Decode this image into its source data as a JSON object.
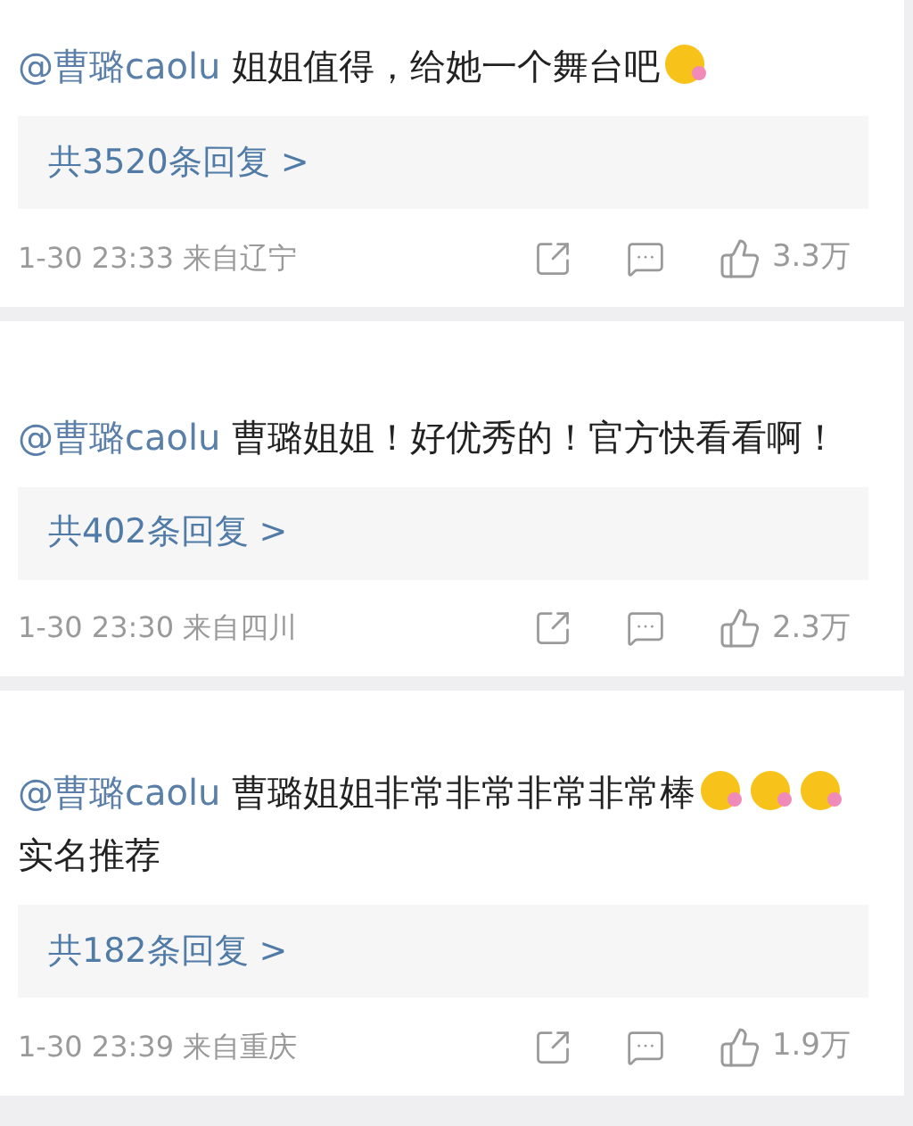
{
  "comments": [
    {
      "mention": "@曹璐caolu",
      "content": [
        {
          "kind": "text",
          "text": "姐姐值得，给她一个舞台吧"
        },
        {
          "kind": "emoji"
        }
      ],
      "replies": "共3520条回复 >",
      "time": "1-30 23:33",
      "location": "来自辽宁",
      "likes": "3.3万"
    },
    {
      "mention": "@曹璐caolu",
      "content": [
        {
          "kind": "text",
          "text": "曹璐姐姐！好优秀的！官方快看看啊！"
        }
      ],
      "replies": "共402条回复 >",
      "time": "1-30 23:30",
      "location": "来自四川",
      "likes": "2.3万"
    },
    {
      "mention": "@曹璐caolu",
      "content": [
        {
          "kind": "text",
          "text": "曹璐姐姐非常非常非常非常棒"
        },
        {
          "kind": "emoji"
        },
        {
          "kind": "emoji"
        },
        {
          "kind": "emoji"
        },
        {
          "kind": "text",
          "text": "实名推荐"
        }
      ],
      "replies": "共182条回复 >",
      "time": "1-30 23:39",
      "location": "来自重庆",
      "likes": "1.9万"
    }
  ]
}
